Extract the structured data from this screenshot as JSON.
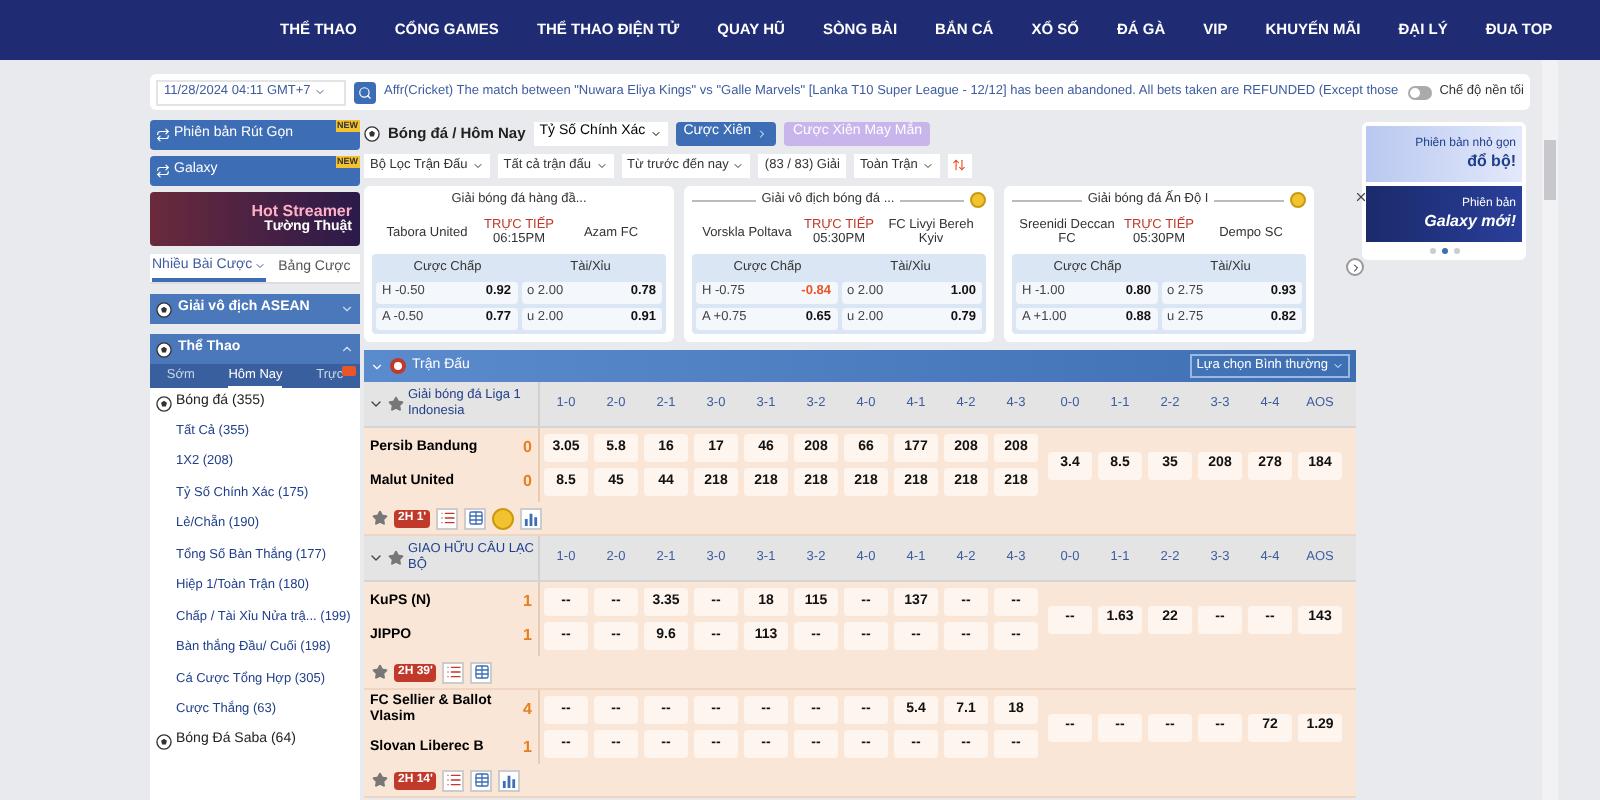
{
  "nav": [
    "THỂ THAO",
    "CỔNG GAMES",
    "THỂ THAO ĐIỆN TỬ",
    "QUAY HŨ",
    "SÒNG BÀI",
    "BẮN CÁ",
    "XỔ SỐ",
    "ĐÁ GÀ",
    "VIP",
    "KHUYẾN MÃI",
    "ĐẠI LÝ",
    "ĐUA TOP"
  ],
  "ticker": {
    "date": "11/28/2024 04:11 GMT+7",
    "message": "Affr(Cricket) The match between \"Nuwara Eliya Kings\" vs \"Galle Marvels\" [Lanka T10 Super League - 12/12] has been abandoned. All bets taken are REFUNDED (Except those",
    "dark_mode": {
      "label": "Chế độ nền tối",
      "on": false
    }
  },
  "sidebar": {
    "versions": [
      {
        "label": "Phiên bản Rút Gọn",
        "badge": "NEW"
      },
      {
        "label": "Galaxy",
        "badge": "NEW"
      }
    ],
    "banner": {
      "title": "Hot Streamer",
      "subtitle": "Tường Thuật"
    },
    "tabs": [
      {
        "label": "Nhiều Bài Cược",
        "selected": true
      },
      {
        "label": "Bảng Cược",
        "selected": false
      }
    ],
    "sections": [
      {
        "label": "Giải vô địch ASEAN",
        "expanded": false
      },
      {
        "label": "Thể Thao",
        "expanded": true
      }
    ],
    "sport_tabs": [
      {
        "label": "Sớm",
        "selected": false
      },
      {
        "label": "Hôm Nay",
        "selected": true
      },
      {
        "label": "Trực",
        "selected": false
      }
    ],
    "sports": [
      {
        "label": "Bóng đá (355)",
        "children": [
          {
            "label": "Tất Cả (355)"
          },
          {
            "label": "1X2 (208)"
          },
          {
            "label": "Tỷ Số Chính Xác (175)"
          },
          {
            "label": "Lẻ/Chẵn (190)"
          },
          {
            "label": "Tổng Số Bàn Thắng (177)"
          },
          {
            "label": "Hiệp 1/Toàn Trận (180)"
          },
          {
            "label": "Chấp / Tài Xỉu Nửa trậ... (199)"
          },
          {
            "label": "Bàn thắng Đầu/ Cuối (198)"
          },
          {
            "label": "Cá Cược Tổng Hợp (305)"
          },
          {
            "label": "Cược Thắng (63)"
          }
        ]
      },
      {
        "label": "Bóng Đá Saba (64)"
      }
    ]
  },
  "header": {
    "breadcrumb": "Bóng đá / Hôm Nay",
    "market": "Tỷ Số Chính Xác",
    "buttons": [
      {
        "label": "Cược Xiên",
        "disabled": false
      },
      {
        "label": "Cược Xiên May Mắn",
        "disabled": true
      }
    ]
  },
  "filters": [
    {
      "label": "Bộ Lọc Trận Đấu",
      "kind": "dropdown"
    },
    {
      "label": "Tất cả trận đấu",
      "kind": "dropdown"
    },
    {
      "label": "Từ trước đến nay",
      "kind": "dropdown"
    },
    {
      "label": "(83 / 83) Giải",
      "kind": "label"
    },
    {
      "label": "Toàn Trận",
      "kind": "dropdown"
    }
  ],
  "cards": [
    {
      "league": "Giải bóng đá hàng đầ...",
      "coin": false,
      "home": "Tabora United",
      "status": "TRỰC TIẾP",
      "time": "06:15PM",
      "away": "Azam FC",
      "columns": [
        "Cược Chấp",
        "Tài/Xỉu"
      ],
      "rows": [
        {
          "hcap": "H -0.50",
          "hodds": "0.92",
          "negative": false,
          "ou": "o 2.00",
          "ouodds": "0.78"
        },
        {
          "hcap": "A -0.50",
          "hodds": "0.77",
          "negative": false,
          "ou": "u 2.00",
          "ouodds": "0.91"
        }
      ]
    },
    {
      "league": "Giải vô địch bóng đá ...",
      "coin": true,
      "home": "Vorskla Poltava",
      "status": "TRỰC TIẾP",
      "time": "05:30PM",
      "away": "FC Livyi Bereh Kyiv",
      "columns": [
        "Cược Chấp",
        "Tài/Xỉu"
      ],
      "rows": [
        {
          "hcap": "H -0.75",
          "hodds": "-0.84",
          "negative": true,
          "ou": "o 2.00",
          "ouodds": "1.00"
        },
        {
          "hcap": "A +0.75",
          "hodds": "0.65",
          "negative": false,
          "ou": "u 2.00",
          "ouodds": "0.79"
        }
      ]
    },
    {
      "league": "Giải bóng đá Ấn Độ I",
      "coin": true,
      "home": "Sreenidi Deccan FC",
      "status": "TRỰC TIẾP",
      "time": "05:30PM",
      "away": "Dempo SC",
      "columns": [
        "Cược Chấp",
        "Tài/Xỉu"
      ],
      "rows": [
        {
          "hcap": "H -1.00",
          "hodds": "0.80",
          "negative": false,
          "ou": "o 2.75",
          "ouodds": "0.93"
        },
        {
          "hcap": "A +1.00",
          "hodds": "0.88",
          "negative": false,
          "ou": "u 2.75",
          "ouodds": "0.82"
        }
      ]
    }
  ],
  "ads": [
    {
      "title": "Phiên bản nhỏ gọn",
      "subtitle": "đổ bộ!"
    },
    {
      "title": "Phiên bản",
      "subtitle": "Galaxy mới!"
    }
  ],
  "ad_dots": [
    {
      "selected": false
    },
    {
      "selected": true
    },
    {
      "selected": false
    }
  ],
  "table": {
    "title": "Trận Đấu",
    "option": "Lựa chọn Bình thường",
    "groups": [
      {
        "league": "Giải bóng đá Liga 1 Indonesia",
        "columns": [
          "1-0",
          "2-0",
          "2-1",
          "3-0",
          "3-1",
          "3-2",
          "4-0",
          "4-1",
          "4-2",
          "4-3",
          "0-0",
          "1-1",
          "2-2",
          "3-3",
          "4-4",
          "AOS"
        ],
        "matches": [
          {
            "home": "Persib Bandung",
            "home_score": "0",
            "away": "Malut United",
            "away_score": "0",
            "home_odds": [
              "3.05",
              "5.8",
              "16",
              "17",
              "46",
              "208",
              "66",
              "177",
              "208",
              "208"
            ],
            "away_odds": [
              "8.5",
              "45",
              "44",
              "218",
              "218",
              "218",
              "218",
              "218",
              "218",
              "218"
            ],
            "draw_odds": [
              "3.4",
              "8.5",
              "35",
              "208",
              "278",
              "184"
            ],
            "live": "2H 1'",
            "tools": [
              {
                "kind": "scores"
              },
              {
                "kind": "board"
              },
              {
                "kind": "coin"
              },
              {
                "kind": "chart"
              }
            ]
          }
        ]
      },
      {
        "league": "GIAO HỮU CÂU LẠC BỘ",
        "columns": [
          "1-0",
          "2-0",
          "2-1",
          "3-0",
          "3-1",
          "3-2",
          "4-0",
          "4-1",
          "4-2",
          "4-3",
          "0-0",
          "1-1",
          "2-2",
          "3-3",
          "4-4",
          "AOS"
        ],
        "matches": [
          {
            "home": "KuPS (N)",
            "home_score": "1",
            "away": "JIPPO",
            "away_score": "1",
            "home_odds": [
              "--",
              "--",
              "3.35",
              "--",
              "18",
              "115",
              "--",
              "137",
              "--",
              "--"
            ],
            "away_odds": [
              "--",
              "--",
              "9.6",
              "--",
              "113",
              "--",
              "--",
              "--",
              "--",
              "--"
            ],
            "draw_odds": [
              "--",
              "1.63",
              "22",
              "--",
              "--",
              "143"
            ],
            "live": "2H 39'",
            "tools": [
              {
                "kind": "scores"
              },
              {
                "kind": "board"
              }
            ]
          },
          {
            "home": "FC Sellier & Ballot Vlasim",
            "home_score": "4",
            "away": "Slovan Liberec B",
            "away_score": "1",
            "home_odds": [
              "--",
              "--",
              "--",
              "--",
              "--",
              "--",
              "--",
              "5.4",
              "7.1",
              "18"
            ],
            "away_odds": [
              "--",
              "--",
              "--",
              "--",
              "--",
              "--",
              "--",
              "--",
              "--",
              "--"
            ],
            "draw_odds": [
              "--",
              "--",
              "--",
              "--",
              "72",
              "1.29"
            ],
            "live": "2H 14'",
            "tools": [
              {
                "kind": "scores"
              },
              {
                "kind": "board"
              },
              {
                "kind": "chart"
              }
            ]
          }
        ]
      }
    ]
  }
}
